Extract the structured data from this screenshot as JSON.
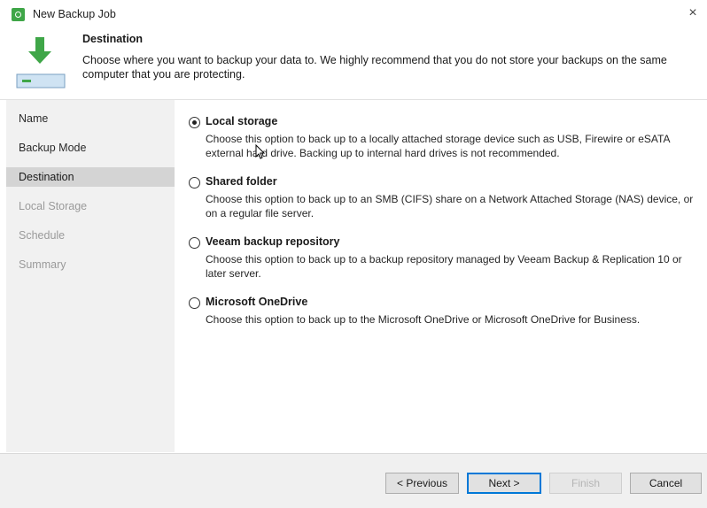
{
  "window": {
    "title": "New Backup Job",
    "close_symbol": "×"
  },
  "header": {
    "title": "Destination",
    "description": "Choose where you want to backup your data to. We highly recommend that you do not store your backups on the same computer that you are protecting."
  },
  "nav": {
    "items": [
      {
        "label": "Name",
        "state": "done"
      },
      {
        "label": "Backup Mode",
        "state": "done"
      },
      {
        "label": "Destination",
        "state": "active"
      },
      {
        "label": "Local Storage",
        "state": "pending"
      },
      {
        "label": "Schedule",
        "state": "pending"
      },
      {
        "label": "Summary",
        "state": "pending"
      }
    ]
  },
  "options": [
    {
      "label": "Local storage",
      "checked": true,
      "description": "Choose this option to back up to a locally attached storage device such as USB, Firewire or eSATA external hard drive. Backing up to internal hard drives is not recommended."
    },
    {
      "label": "Shared folder",
      "checked": false,
      "description": "Choose this option to back up to an SMB (CIFS) share on a Network Attached Storage (NAS) device, or on a regular file server."
    },
    {
      "label": "Veeam backup repository",
      "checked": false,
      "description": "Choose this option to back up to a backup repository managed by Veeam Backup & Replication 10 or later server."
    },
    {
      "label": "Microsoft OneDrive",
      "checked": false,
      "description": "Choose this option to back up to the Microsoft OneDrive or Microsoft OneDrive for Business."
    }
  ],
  "footer": {
    "previous_label": "< Previous",
    "next_label": "Next >",
    "finish_label": "Finish",
    "cancel_label": "Cancel",
    "finish_enabled": false
  },
  "icons": {
    "app": "veeam-app-icon",
    "header": "download-arrow-drive-icon",
    "close": "close-icon",
    "cursor": "mouse-cursor-icon"
  },
  "colors": {
    "accent_green": "#3fa648",
    "nav_active_bg": "#d4d4d4",
    "nav_bg": "#f1f1f1",
    "default_button_border": "#0078d7"
  }
}
